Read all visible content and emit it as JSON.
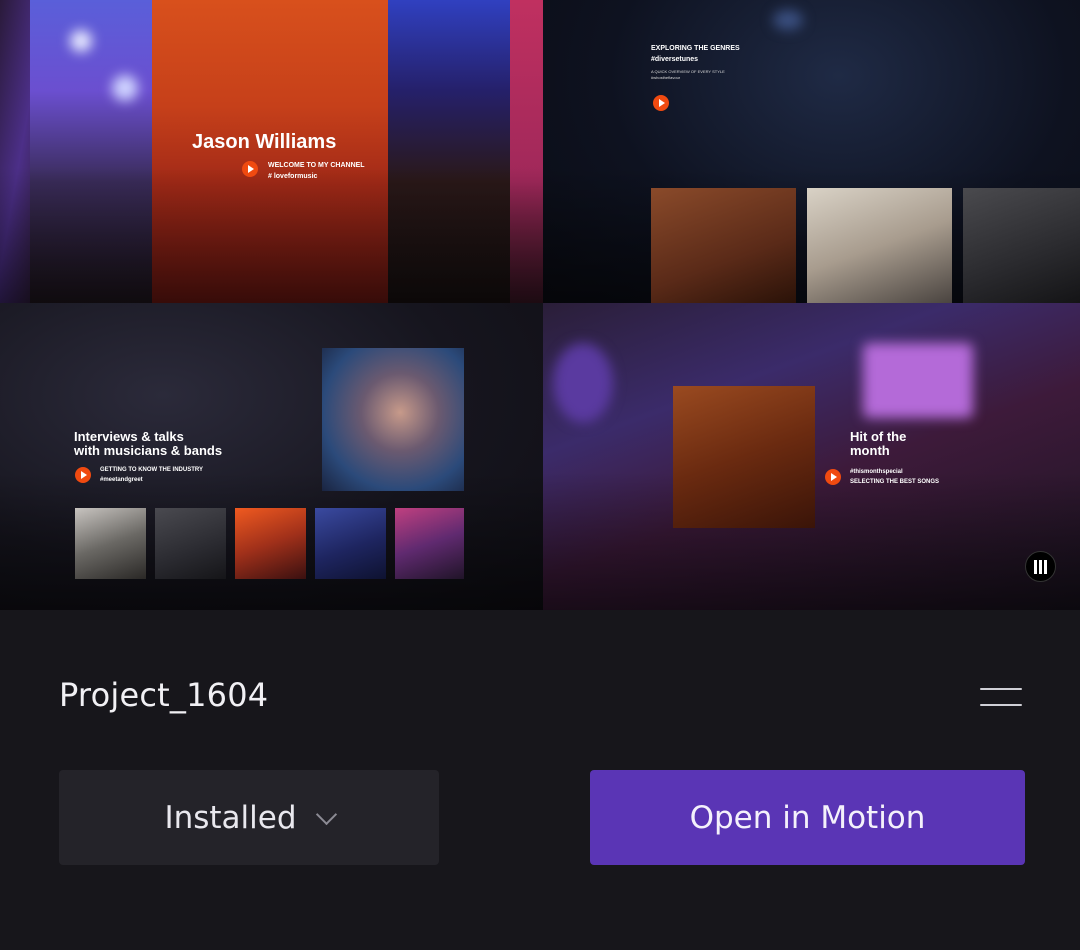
{
  "preview": {
    "jason": {
      "name": "Jason Williams",
      "line1": "WELCOME TO MY CHANNEL",
      "line2": "#  loveformusic"
    },
    "genres": {
      "line1": "EXPLORING THE GENRES",
      "line2": "#diversetunes",
      "small1": "A QUICK OVERVIEW OF EVERY STYLE",
      "small2": "#whostheflavour"
    },
    "interviews": {
      "title1": "Interviews & talks",
      "title2": "with musicians & bands",
      "sub1": "GETTING TO KNOW THE INDUSTRY",
      "sub2": "#meetandgreet"
    },
    "hit": {
      "title1": "Hit of the",
      "title2": "month",
      "sub1": "#thismonthspecial",
      "sub2": "SELECTING THE BEST SONGS"
    }
  },
  "card": {
    "project_name": "Project_1604",
    "installed_label": "Installed",
    "open_label": "Open in Motion"
  },
  "colors": {
    "background": "#17161b",
    "installed_button": "#242329",
    "accent": "#5a35b5",
    "play_icon": "#f04a10"
  }
}
